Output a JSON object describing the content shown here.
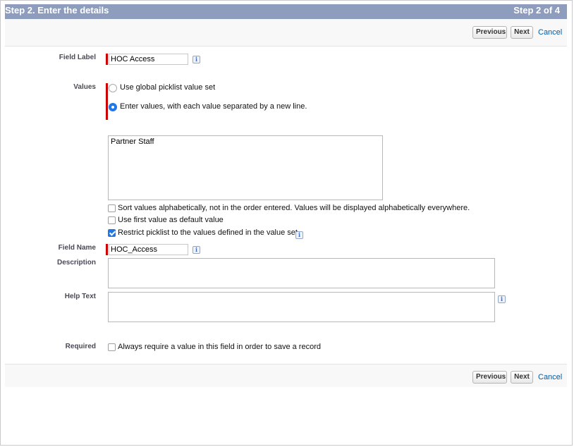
{
  "header": {
    "title": "Step 2. Enter the details",
    "step": "Step 2 of 4"
  },
  "nav": {
    "previous_label": "Previous",
    "next_label": "Next",
    "cancel_label": "Cancel"
  },
  "form": {
    "field_label": {
      "label": "Field Label",
      "value": "HOC Access"
    },
    "values": {
      "label": "Values",
      "option_global": "Use global picklist value set",
      "option_enter": "Enter values, with each value separated by a new line.",
      "selected": "enter",
      "textarea_value": "Partner Staff"
    },
    "checks": {
      "sort_label": "Sort values alphabetically, not in the order entered. Values will be displayed alphabetically everywhere.",
      "sort_checked": false,
      "first_default_label": "Use first value as default value",
      "first_default_checked": false,
      "restrict_label": "Restrict picklist to the values defined in the value set.",
      "restrict_checked": true
    },
    "field_name": {
      "label": "Field Name",
      "value": "HOC_Access"
    },
    "description": {
      "label": "Description",
      "value": ""
    },
    "help_text": {
      "label": "Help Text",
      "value": ""
    },
    "required": {
      "label": "Required",
      "option": "Always require a value in this field in order to save a record",
      "checked": false
    }
  },
  "icons": {
    "info": "i"
  }
}
